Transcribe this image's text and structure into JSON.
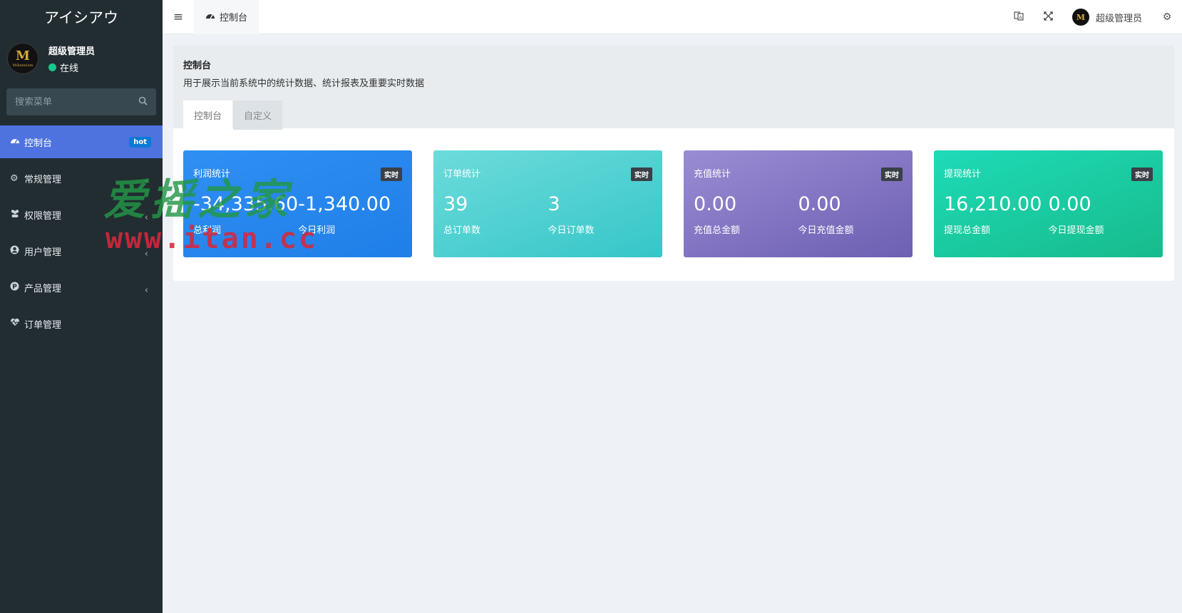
{
  "app": {
    "title": "アイシアウ"
  },
  "user": {
    "name": "超级管理员",
    "status": "在线",
    "avatar_text": "M",
    "avatar_sub": "Millennium"
  },
  "sidebar": {
    "search_placeholder": "搜索菜单",
    "items": [
      {
        "label": "控制台",
        "icon": "dashboard-icon",
        "badge": "hot",
        "active": true
      },
      {
        "label": "常规管理",
        "icon": "cogs-icon",
        "has_children": true
      },
      {
        "label": "权限管理",
        "icon": "users-icon",
        "has_children": true
      },
      {
        "label": "用户管理",
        "icon": "user-circle-icon",
        "has_children": true
      },
      {
        "label": "产品管理",
        "icon": "product-p-icon",
        "has_children": true
      },
      {
        "label": "订单管理",
        "icon": "heartbeat-icon",
        "has_children": false
      }
    ]
  },
  "topbar": {
    "tab_label": "控制台",
    "user_name": "超级管理员",
    "icons": [
      "translate-icon",
      "fullscreen-icon",
      "settings-icon"
    ]
  },
  "page": {
    "title": "控制台",
    "description": "用于展示当前系统中的统计数据、统计报表及重要实时数据",
    "tabs": [
      "控制台",
      "自定义"
    ]
  },
  "cards": [
    {
      "title": "利润统计",
      "badge": "实时",
      "value1": "-34,335.60",
      "label1": "总利润",
      "value2": "-1,340.00",
      "label2": "今日利润",
      "color": "#2a8af0"
    },
    {
      "title": "订单统计",
      "badge": "实时",
      "value1": "39",
      "label1": "总订单数",
      "value2": "3",
      "label2": "今日订单数",
      "color": "#4fcfd0"
    },
    {
      "title": "充值统计",
      "badge": "实时",
      "value1": "0.00",
      "label1": "充值总金额",
      "value2": "0.00",
      "label2": "今日充值金额",
      "color": "#8175c2"
    },
    {
      "title": "提现统计",
      "badge": "实时",
      "value1": "16,210.00",
      "label1": "提现总金额",
      "value2": "0.00",
      "label2": "今日提现金额",
      "color": "#1acca2"
    }
  ],
  "watermark": {
    "line1": "爱摇之家",
    "line2": "www.itan.cc"
  }
}
